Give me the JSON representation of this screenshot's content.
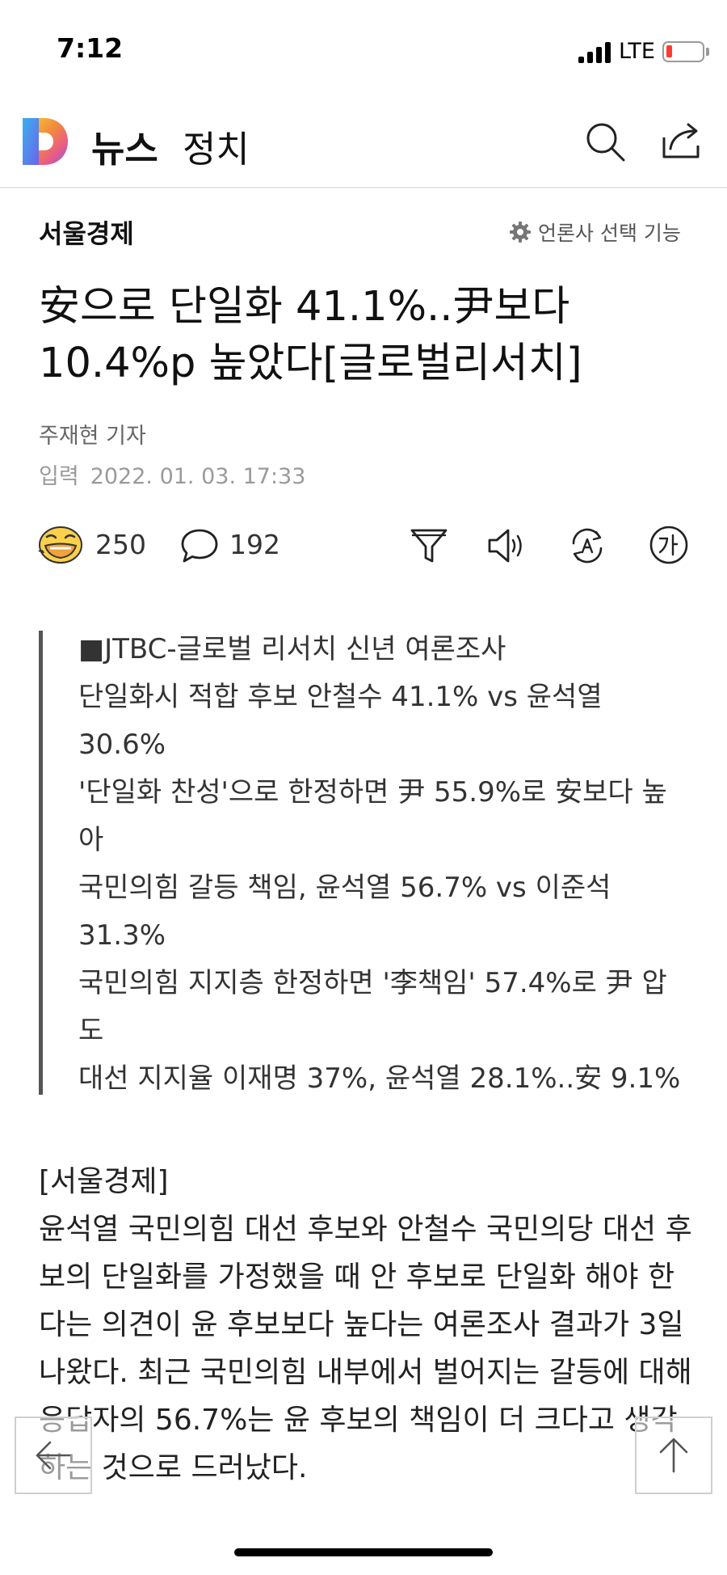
{
  "status_bar": {
    "time": "7:12",
    "network": "LTE"
  },
  "header": {
    "nav_news": "뉴스",
    "nav_section": "정치",
    "logo_icon": "daum-d-logo",
    "colors": {
      "logo_gradient": [
        "#f6d33a",
        "#f28a3b",
        "#6c63e8",
        "#3bb0f0"
      ]
    }
  },
  "article": {
    "press": "서울경제",
    "press_settings_label": "언론사 선택 기능",
    "title": "安으로 단일화 41.1%..尹보다 10.4%p 높았다[글로벌리서치]",
    "reporter": "주재현 기자",
    "date_label": "입력",
    "date_value": "2022. 01. 03. 17:33",
    "likes": "250",
    "comments": "192",
    "summary": [
      "■JTBC-글로벌 리서치 신년 여론조사",
      "단일화시 적합 후보 안철수 41.1% vs 윤석열 30.6%",
      "'단일화 찬성'으로 한정하면 尹 55.9%로 安보다 높아",
      "국민의힘 갈등 책임, 윤석열 56.7% vs 이준석 31.3%",
      "국민의힘 지지층 한정하면 '李책임' 57.4%로 尹 압도",
      "대선 지지율 이재명 37%, 윤석열 28.1%..安 9.1%"
    ],
    "body_press_tag": "[서울경제]",
    "body_paragraph": "윤석열 국민의힘 대선 후보와 안철수 국민의당 대선 후보의 단일화를 가정했을 때 안 후보로 단일화 해야 한다는 의견이 윤 후보보다 높다는 여론조사 결과가 3일 나왔다. 최근 국민의힘 내부에서 벌어지는 갈등에 대해 응답자의 56.7%는 윤 후보의 책임이 더 크다고 생각하는 것으로 드러났다."
  }
}
